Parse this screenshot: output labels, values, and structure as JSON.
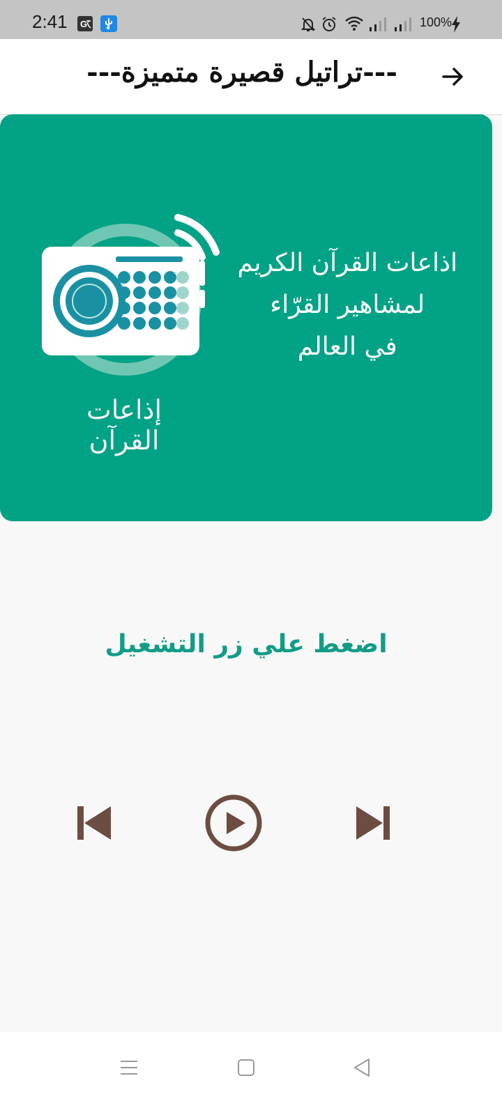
{
  "status_bar": {
    "time": "2:41",
    "battery": "100%",
    "icons": [
      "translate-icon",
      "usb-icon",
      "bell-off-icon",
      "alarm-icon",
      "wifi-icon",
      "signal-icon",
      "signal-icon",
      "charging-icon"
    ]
  },
  "app_bar": {
    "title": "---تراتيل قصيرة متميزة---",
    "forward_icon": "arrow-right-icon"
  },
  "banner": {
    "headline_lines": [
      "اذاعات القرآن الكريم",
      "لمشاهير القرّاء",
      "في العالم"
    ],
    "logo_caption": "إذاعات القرآن",
    "colors": {
      "background": "#01a285",
      "radio_body": "#ffffff",
      "dots": "#1a91a3"
    }
  },
  "player": {
    "instruction": "اضغط علي زر التشغيل",
    "controls": [
      "skip-previous-icon",
      "play-icon",
      "skip-next-icon"
    ],
    "control_color": "#6d4c41",
    "instruction_color": "#129c87"
  },
  "nav_bar": {
    "buttons": [
      "menu-icon",
      "home-icon",
      "back-icon"
    ]
  }
}
